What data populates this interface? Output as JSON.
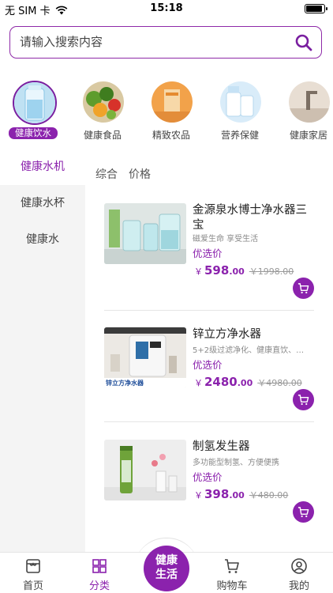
{
  "status": {
    "carrier": "无 SIM 卡",
    "time": "15:18",
    "battery_level": 0.9
  },
  "search": {
    "placeholder": "请输入搜索内容"
  },
  "categories": [
    {
      "label": "健康饮水",
      "active": true,
      "icon": "water-bottle-image"
    },
    {
      "label": "健康食品",
      "active": false,
      "icon": "vegetables-image"
    },
    {
      "label": "精致农品",
      "active": false,
      "icon": "farm-produce-image"
    },
    {
      "label": "营养保健",
      "active": false,
      "icon": "supplements-image"
    },
    {
      "label": "健康家居",
      "active": false,
      "icon": "faucet-image"
    }
  ],
  "side_nav": [
    {
      "label": "健康水机",
      "active": true
    },
    {
      "label": "健康水杯",
      "active": false
    },
    {
      "label": "健康水",
      "active": false
    }
  ],
  "sort": {
    "comprehensive": "综合",
    "price": "价格"
  },
  "products": [
    {
      "name": "金源泉水博士净水器三宝",
      "desc": "磁爱生命 享受生活",
      "tag": "优选价",
      "currency": "￥",
      "price_int": "598",
      "price_dec": ".00",
      "old_price": "￥1998.00"
    },
    {
      "name": "锌立方净水器",
      "desc": "5+2级过滤净化、健康直饮、…",
      "tag": "优选价",
      "currency": "￥",
      "price_int": "2480",
      "price_dec": ".00",
      "old_price": "￥4980.00",
      "thumb_caption": "锌立方净水器"
    },
    {
      "name": "制氢发生器",
      "desc": "多功能型制氢、方便便携",
      "tag": "优选价",
      "currency": "￥",
      "price_int": "398",
      "price_dec": ".00",
      "old_price": "￥480.00"
    }
  ],
  "tabs": {
    "home": "首页",
    "category": "分类",
    "center_line1": "健康",
    "center_line2": "生活",
    "cart": "购物车",
    "mine": "我的"
  },
  "colors": {
    "accent": "#8b22ad"
  }
}
